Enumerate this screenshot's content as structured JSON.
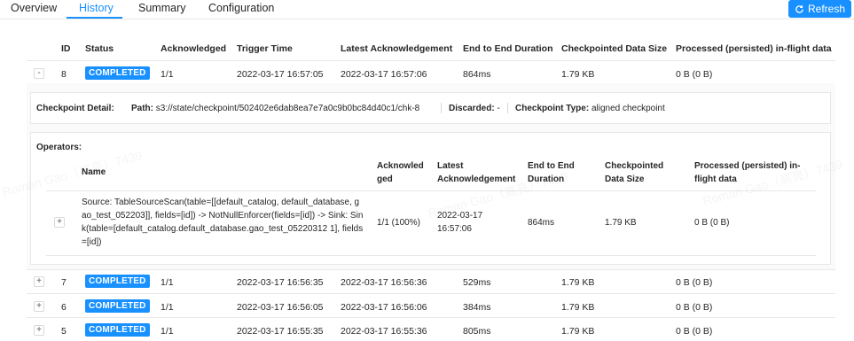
{
  "tabs": [
    {
      "label": "Overview",
      "active": false
    },
    {
      "label": "History",
      "active": true
    },
    {
      "label": "Summary",
      "active": false
    },
    {
      "label": "Configuration",
      "active": false
    }
  ],
  "refresh": {
    "label": "Refresh",
    "icon": "refresh-icon"
  },
  "table": {
    "headers": {
      "id": "ID",
      "status": "Status",
      "acknowledged": "Acknowledged",
      "trigger_time": "Trigger Time",
      "latest_ack": "Latest Acknowledgement",
      "e2e": "End to End Duration",
      "size": "Checkpointed Data Size",
      "processed": "Processed (persisted) in-flight data"
    },
    "rows": [
      {
        "expander": "-",
        "id": "8",
        "status": "COMPLETED",
        "acknowledged": "1/1",
        "trigger_time": "2022-03-17 16:57:05",
        "latest_ack": "2022-03-17 16:57:06",
        "e2e": "864ms",
        "size": "1.79 KB",
        "processed": "0 B (0 B)"
      },
      {
        "expander": "+",
        "id": "7",
        "status": "COMPLETED",
        "acknowledged": "1/1",
        "trigger_time": "2022-03-17 16:56:35",
        "latest_ack": "2022-03-17 16:56:36",
        "e2e": "529ms",
        "size": "1.79 KB",
        "processed": "0 B (0 B)"
      },
      {
        "expander": "+",
        "id": "6",
        "status": "COMPLETED",
        "acknowledged": "1/1",
        "trigger_time": "2022-03-17 16:56:05",
        "latest_ack": "2022-03-17 16:56:06",
        "e2e": "384ms",
        "size": "1.79 KB",
        "processed": "0 B (0 B)"
      },
      {
        "expander": "+",
        "id": "5",
        "status": "COMPLETED",
        "acknowledged": "1/1",
        "trigger_time": "2022-03-17 16:55:35",
        "latest_ack": "2022-03-17 16:55:36",
        "e2e": "805ms",
        "size": "1.79 KB",
        "processed": "0 B (0 B)"
      }
    ]
  },
  "detail": {
    "title": "Checkpoint Detail:",
    "path_label": "Path:",
    "path_value": "s3://state/checkpoint/502402e6dab8ea7e7a0c9b0bc84d40c1/chk-8",
    "discarded_label": "Discarded:",
    "discarded_value": "-",
    "type_label": "Checkpoint Type:",
    "type_value": "aligned checkpoint"
  },
  "operators": {
    "title": "Operators:",
    "headers": {
      "name": "Name",
      "acknowledged": "Acknowledged",
      "latest_ack": "Latest Acknowledgement",
      "e2e": "End to End Duration",
      "size": "Checkpointed Data Size",
      "processed": "Processed (persisted) in-flight data"
    },
    "rows": [
      {
        "expander": "+",
        "name": "Source: TableSourceScan(table=[[default_catalog, default_database, gao_test_052203]], fields=[id]) -> NotNullEnforcer(fields=[id]) -> Sink: Sink(table=[default_catalog.default_database.gao_test_05220312 1], fields=[id])",
        "acknowledged": "1/1 (100%)",
        "latest_ack": "2022-03-17 16:57:06",
        "e2e": "864ms",
        "size": "1.79 KB",
        "processed": "0 B (0 B)"
      }
    ]
  },
  "watermark_text": "Roman Gao（高亮）7439"
}
